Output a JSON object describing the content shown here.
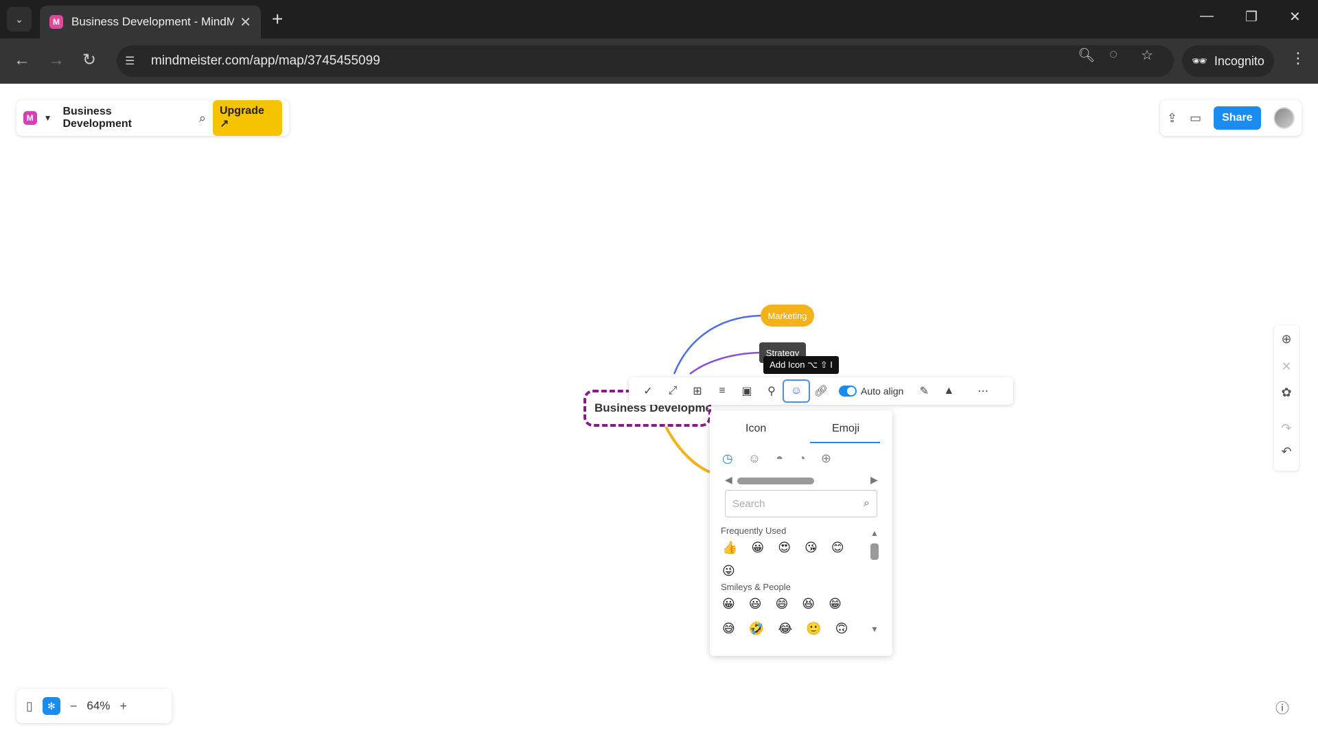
{
  "browser": {
    "tab_title": "Business Development - MindM",
    "tab_favicon_letter": "M",
    "url": "mindmeister.com/app/map/3745455099",
    "incognito_label": "Incognito",
    "icons": [
      "tab-list-icon",
      "close-icon",
      "new-tab-icon",
      "minimize-icon",
      "restore-icon",
      "window-close-icon",
      "back-icon",
      "forward-icon",
      "reload-icon",
      "site-settings-icon",
      "zoom-icon",
      "eye-slash-icon",
      "star-icon",
      "incognito-icon",
      "kebab-menu-icon"
    ]
  },
  "app": {
    "logo_letter": "M",
    "map_title": "Business Development",
    "upgrade_label": "Upgrade ↗",
    "share_label": "Share",
    "accent": "#1a8cf0",
    "upgrade_color": "#f6c300"
  },
  "map": {
    "central_topic": "Business Development",
    "nodes": [
      {
        "label": "Marketing",
        "color": "#f2b21a"
      },
      {
        "label": "Strategy",
        "color": "#444444"
      }
    ],
    "tooltip": "Add Icon ⌥ ⇧ I"
  },
  "toolbar": {
    "auto_align_label": "Auto align",
    "auto_align_on": true
  },
  "emoji_panel": {
    "tabs": [
      "Icon",
      "Emoji"
    ],
    "active_tab": "Emoji",
    "search_placeholder": "Search",
    "sections": [
      {
        "title": "Frequently Used",
        "emojis": [
          "👍",
          "😀",
          "😍",
          "😘",
          "😊",
          "😜"
        ]
      },
      {
        "title": "Smileys & People",
        "emojis": [
          "😀",
          "😃",
          "😄",
          "😆",
          "😁",
          "😅",
          "🤣",
          "😂",
          "🙂",
          "🙃"
        ]
      }
    ]
  },
  "zoom": {
    "level": "64%"
  }
}
